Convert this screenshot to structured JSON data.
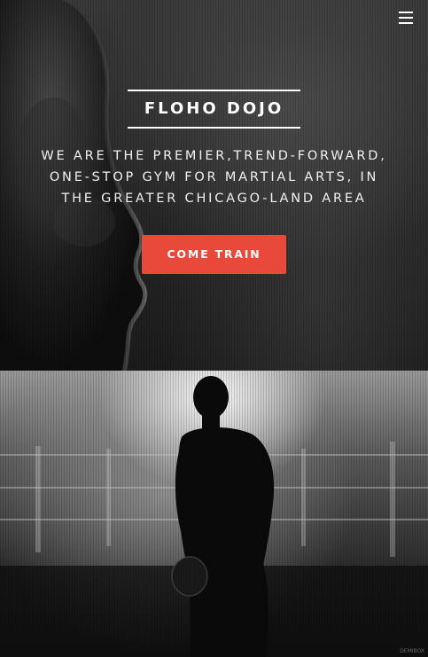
{
  "nav": {
    "menu_icon": "hamburger-menu-icon"
  },
  "hero": {
    "brand": "FLOHO DOJO",
    "tagline_lines": [
      "WE ARE THE PREMIER,TREND-FORWARD,",
      "ONE-STOP GYM FOR MARTIAL ARTS, IN",
      "THE GREATER CHICAGO-LAND AREA"
    ],
    "cta_label": "COME TRAIN"
  },
  "section_two": {
    "watermark": "DEMIBOX"
  },
  "colors": {
    "accent": "#e9493a",
    "text": "#ffffff"
  }
}
